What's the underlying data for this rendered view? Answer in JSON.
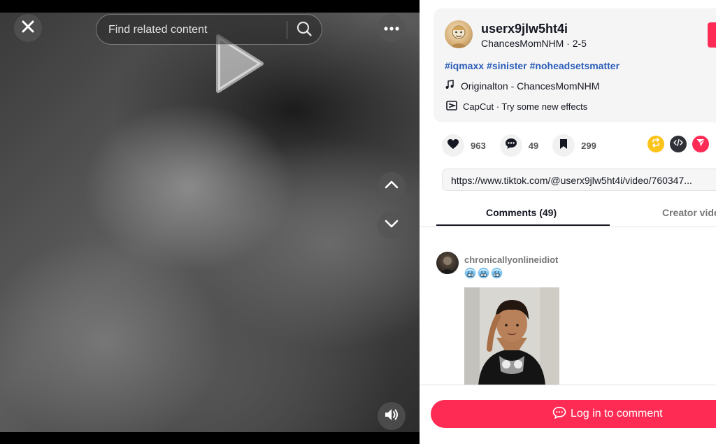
{
  "video": {
    "search": {
      "placeholder": "Find related content"
    }
  },
  "author": {
    "username": "userx9jlw5ht4i",
    "display_name": "ChancesMomNHM",
    "date": "2-5",
    "separator": " · "
  },
  "description": {
    "hashtags": [
      "#iqmaxx",
      "#sinister",
      "#noheadsetsmatter"
    ]
  },
  "music": {
    "label": "Originalton - ChancesMomNHM"
  },
  "capcut": {
    "label": "CapCut · Try some new effects"
  },
  "actions": {
    "likes": "963",
    "comments": "49",
    "saves": "299"
  },
  "link": {
    "url": "https://www.tiktok.com/@userx9jlw5ht4i/video/760347..."
  },
  "tabs": {
    "comments": "Comments (49)",
    "creator": "Creator videos"
  },
  "comments": [
    {
      "username": "chronicallyonlineidiot",
      "emojis": [
        "cold-face-emoji",
        "cold-face-emoji",
        "cold-face-emoji"
      ]
    }
  ],
  "bottom": {
    "login_label": "Log in to comment"
  },
  "colors": {
    "accent": "#fe2c55",
    "hashtag": "#2b5db9",
    "repost": "#fcc31b",
    "embed": "#2f3038"
  }
}
